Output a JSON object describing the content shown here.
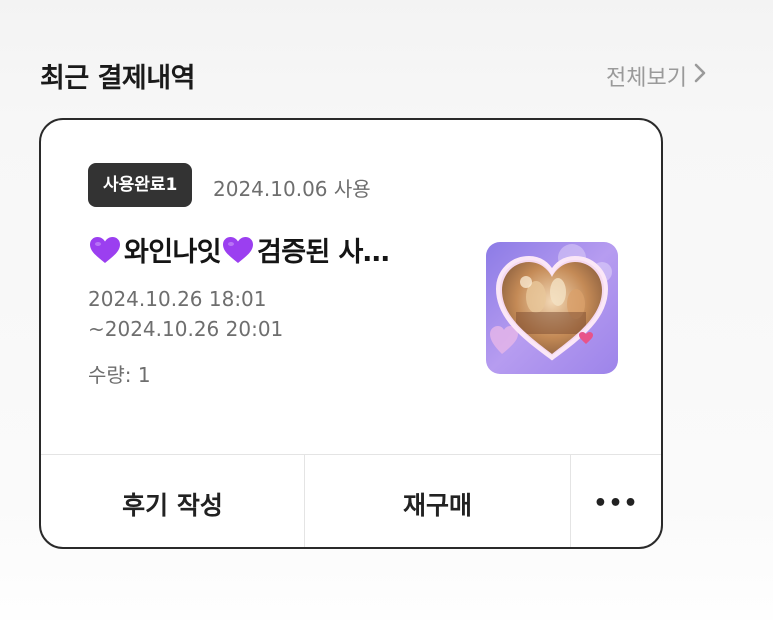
{
  "section": {
    "title": "최근 결제내역",
    "see_all_label": "전체보기"
  },
  "order": {
    "status_badge": "사용완료1",
    "used_date": "2024.10.06 사용",
    "product_name": "와인나잇",
    "product_name_rest": "검증된 사…",
    "name_icon": "purple-heart-emoji",
    "date_start": "2024.10.26 18:01",
    "date_end": " ~2024.10.26 20:01",
    "quantity": "수량: 1",
    "thumbnail_icon": "heart-frame-wine-party-image"
  },
  "actions": {
    "review_label": "후기 작성",
    "rebuy_label": "재구매",
    "more_label": "•••"
  },
  "colors": {
    "badge_bg": "#333333",
    "muted_text": "#6e6e6e",
    "card_border": "#2a2a2a",
    "heart_purple": "#9b3ff0"
  }
}
